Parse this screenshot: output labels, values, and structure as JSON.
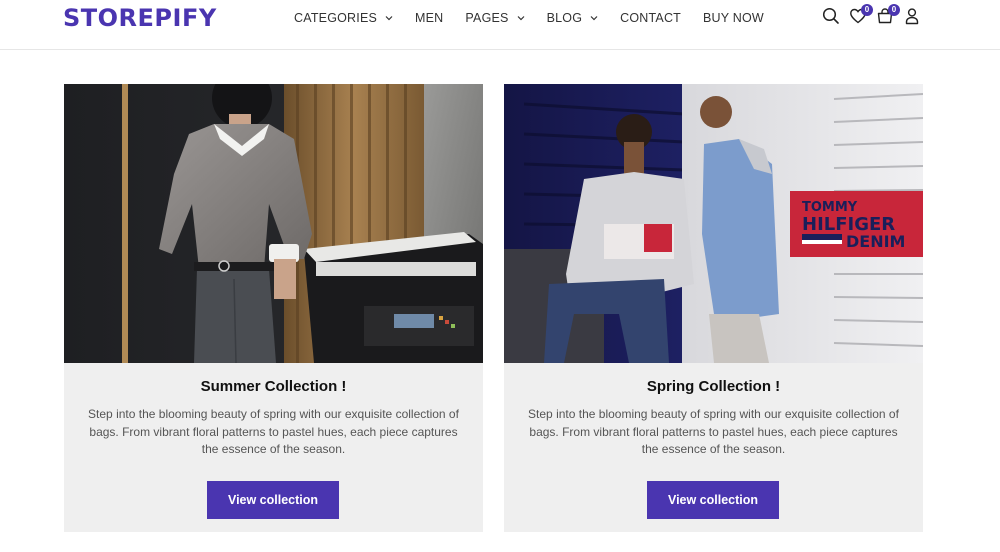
{
  "header": {
    "logo": "STOREPIFY",
    "nav": [
      {
        "label": "CATEGORIES",
        "has_dropdown": true
      },
      {
        "label": "MEN",
        "has_dropdown": false
      },
      {
        "label": "PAGES",
        "has_dropdown": true
      },
      {
        "label": "BLOG",
        "has_dropdown": true
      },
      {
        "label": "CONTACT",
        "has_dropdown": false
      },
      {
        "label": "BUY NOW",
        "has_dropdown": false
      }
    ],
    "icons": {
      "search": "search-icon",
      "wishlist": "heart-icon",
      "wishlist_count": "0",
      "cart": "cart-icon",
      "cart_count": "0",
      "account": "user-icon"
    }
  },
  "collections": [
    {
      "title": "Summer Collection !",
      "description": "Step into the blooming beauty of spring with our exquisite collection of bags. From vibrant floral patterns to pastel hues, each piece captures the essence of the season.",
      "button": "View collection"
    },
    {
      "title": "Spring Collection !",
      "description": "Step into the blooming beauty of spring with our exquisite collection of bags. From vibrant floral patterns to pastel hues, each piece captures the essence of the season.",
      "button": "View collection",
      "image_sign": [
        "TOMMY",
        "HILFIGER",
        "DENIM"
      ]
    }
  ],
  "colors": {
    "brand": "#4a35b0",
    "card_bg": "#efefef"
  }
}
